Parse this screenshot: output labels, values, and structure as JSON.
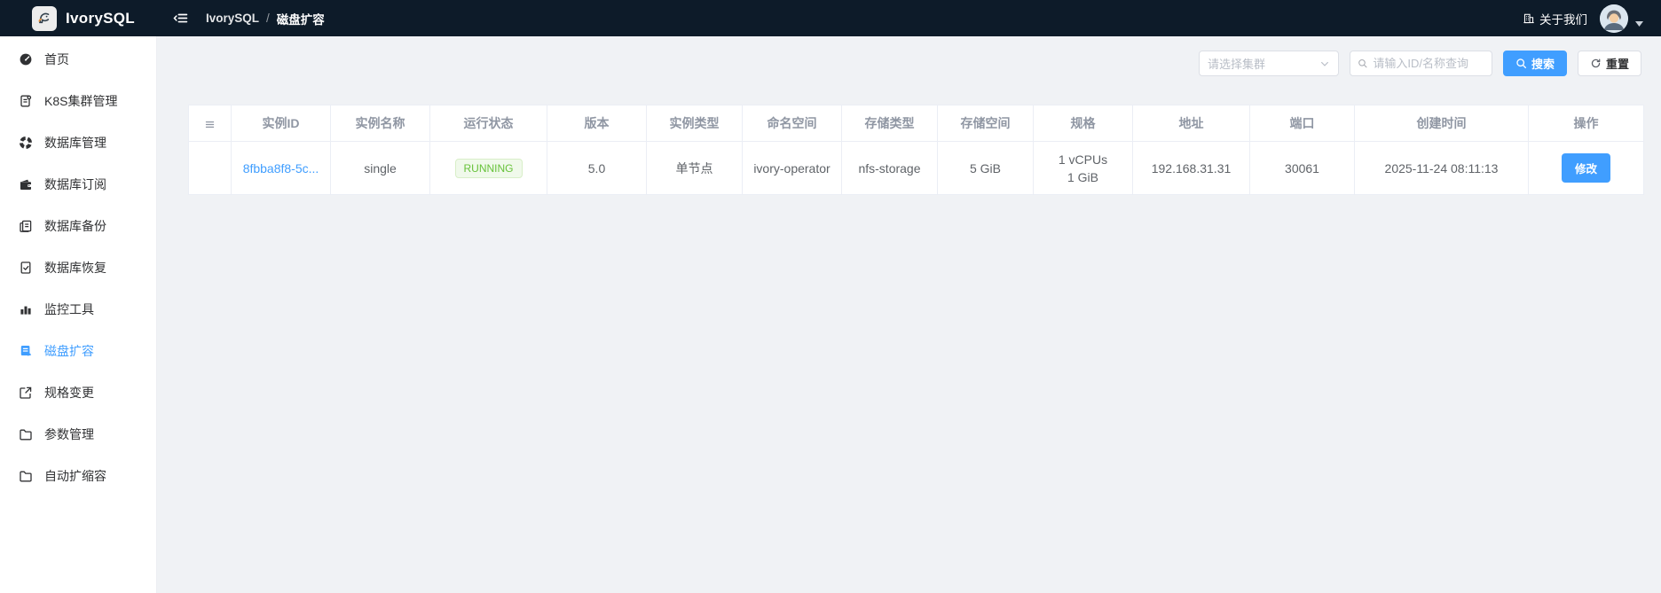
{
  "topbar": {
    "logo_text": "IvorySQL",
    "breadcrumb": {
      "root": "IvorySQL",
      "separator": "/",
      "current": "磁盘扩容"
    },
    "about_label": "关于我们"
  },
  "sidebar": {
    "items": [
      {
        "label": "首页",
        "icon": "dashboard-icon",
        "active": false
      },
      {
        "label": "K8S集群管理",
        "icon": "cluster-icon",
        "active": false
      },
      {
        "label": "数据库管理",
        "icon": "database-manage-icon",
        "active": false
      },
      {
        "label": "数据库订阅",
        "icon": "subscription-icon",
        "active": false
      },
      {
        "label": "数据库备份",
        "icon": "backup-icon",
        "active": false
      },
      {
        "label": "数据库恢复",
        "icon": "restore-icon",
        "active": false
      },
      {
        "label": "监控工具",
        "icon": "monitor-icon",
        "active": false
      },
      {
        "label": "磁盘扩容",
        "icon": "disk-expand-icon",
        "active": true
      },
      {
        "label": "规格变更",
        "icon": "spec-change-icon",
        "active": false
      },
      {
        "label": "参数管理",
        "icon": "folder-icon",
        "active": false
      },
      {
        "label": "自动扩缩容",
        "icon": "folder-icon",
        "active": false
      }
    ]
  },
  "filters": {
    "cluster_select_placeholder": "请选择集群",
    "search_input_placeholder": "请输入ID/名称查询",
    "search_button": "搜索",
    "reset_button": "重置"
  },
  "table": {
    "columns": [
      "",
      "实例ID",
      "实例名称",
      "运行状态",
      "版本",
      "实例类型",
      "命名空间",
      "存储类型",
      "存储空间",
      "规格",
      "地址",
      "端口",
      "创建时间",
      "操作"
    ],
    "rows": [
      {
        "instance_id": "8fbba8f8-5c...",
        "instance_name": "single",
        "status": "RUNNING",
        "version": "5.0",
        "instance_type": "单节点",
        "namespace": "ivory-operator",
        "storage_type": "nfs-storage",
        "storage_size": "5 GiB",
        "spec_line1": "1 vCPUs",
        "spec_line2": "1 GiB",
        "address": "192.168.31.31",
        "port": "30061",
        "created_at": "2025-11-24 08:11:13",
        "action": "修改"
      }
    ]
  },
  "colors": {
    "topbar_bg": "#0d1b29",
    "primary": "#409eff",
    "success_text": "#67c23a",
    "success_bg": "#f0f9eb",
    "success_border": "#d8efc8",
    "main_bg": "#f0f2f5",
    "table_border": "#ebeef5"
  }
}
